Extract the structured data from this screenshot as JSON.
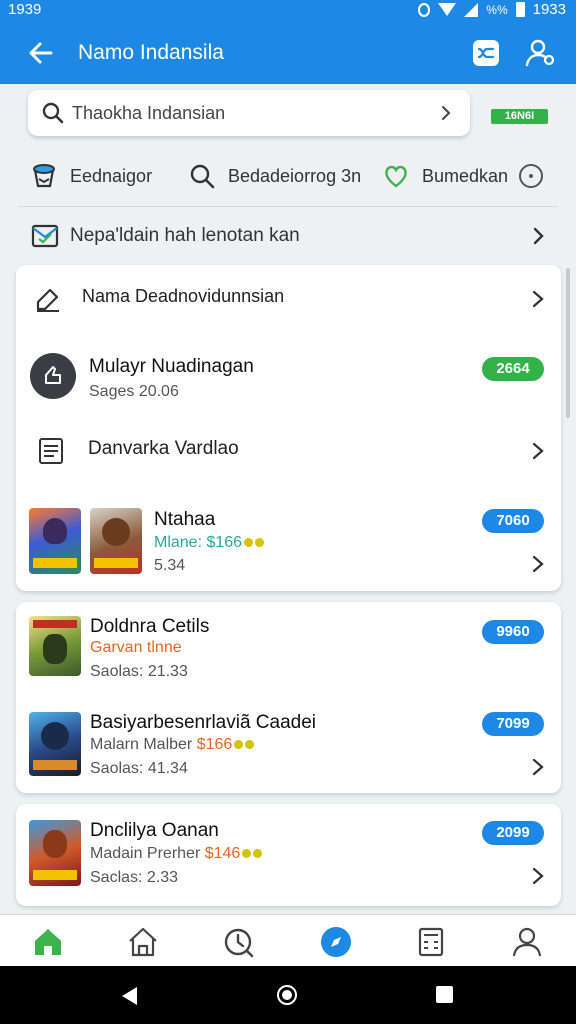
{
  "status_bar": {
    "time": "1939",
    "battery_pct": "%%",
    "clock": "1933"
  },
  "app_bar": {
    "title": "Namo Indansila"
  },
  "search": {
    "value": "Thaokha Indansian"
  },
  "top_badge": "16N6I",
  "quick_actions": [
    {
      "label": "Eednaigor",
      "icon": "cup-icon"
    },
    {
      "label": "Bedadeiorrog 3n",
      "icon": "search-icon"
    },
    {
      "label": "Bumedkan",
      "icon": "heart-icon"
    },
    {
      "label": "",
      "icon": "more-icon"
    }
  ],
  "notice": {
    "label": "Nepa'ldain hah lenotan kan"
  },
  "card1": {
    "menu_row": {
      "label": "Nama Deadnovidunnsian"
    },
    "profile": {
      "name": "Mulayr Nuadinagan",
      "sub": "Sages 20.06",
      "badge": "2664"
    },
    "doc_row": {
      "label": "Danvarka Vardlao"
    },
    "game": {
      "title": "Ntahaa",
      "sub": "Mlane: $166",
      "meta": "5.34",
      "pill": "7060"
    }
  },
  "card2": {
    "items": [
      {
        "title": "Doldnra Cetils",
        "sub": "Garvan tlnne",
        "meta": "Saolas: 21.33",
        "pill": "9960"
      },
      {
        "title": "Basiyarbesenrlaviã Caadei",
        "sub": "Malarn Malber",
        "price": "$166",
        "meta": "Saolas: 41.34",
        "pill": "7099"
      }
    ]
  },
  "card3": {
    "item": {
      "title": "Dnclilya Oanan",
      "sub": "Madain Prerher",
      "price": "$146",
      "meta": "Saclas: 2.33",
      "pill": "2099"
    }
  },
  "colors": {
    "primary": "#1e88e5",
    "accent_green": "#33b24a",
    "price_orange": "#e8661e",
    "sub_teal": "#2aa79b"
  },
  "bottom_nav": [
    "home-icon",
    "house-icon",
    "history-icon",
    "explore-icon",
    "calculator-icon",
    "profile-icon"
  ]
}
